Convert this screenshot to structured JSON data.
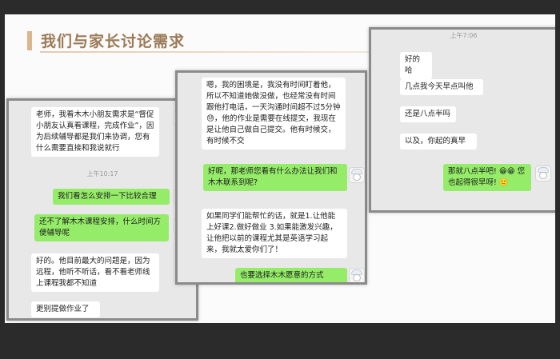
{
  "slide": {
    "title": "我们与家长讨论需求"
  },
  "chat_left": {
    "messages": [
      {
        "text": "老师，我看木木小朋友需求是“督促小朋友认真看课程，完成作业”，因为后续辅导都是我们来协调，您有什么需要直接和我说就行"
      },
      {
        "text": "我们看怎么安排一下比较合理"
      },
      {
        "text": "还不了解木木课程安排，什么时间方便辅导呢"
      },
      {
        "text": "好的。他目前最大的问题是，因为远程，他听不听话，看不看老师线上课程我都不知道"
      },
      {
        "text": "更别提做作业了"
      }
    ],
    "timestamp": "上午10:17"
  },
  "chat_middle": {
    "messages": [
      {
        "text": "嗯，我的困境是，我没有时间盯着他，所以不知道她做没做，也经常没有时间跟他打电话，一天沟通时间超不过5分钟😓，他的作业是需要在线提交，我现在是让他自己做自己提交。他有时候交，有时候不交"
      },
      {
        "text": "好呢，那老师您看有什么办法让我们和木木联系到呢?"
      },
      {
        "text": "如果同学们能帮忙的话，就是1.让他能上好课2.做好做业 3.如果能激发兴趣，让他把以前的课程尤其是英语学习起来，我就太爱你们了！"
      },
      {
        "text": "也要选择木木愿意的方式"
      }
    ]
  },
  "chat_right": {
    "timestamp": "上午7:06",
    "messages": [
      {
        "text": "好的哈"
      },
      {
        "text": "几点我今天早点叫他"
      },
      {
        "text": "还是八点半吗"
      },
      {
        "text": "以及，你起的真早"
      },
      {
        "text": "那就八点半吧! 😁😁 您也起得很早呀! 🙂"
      }
    ]
  },
  "avatar_icon": "cartoon-chef-avatar-icon"
}
